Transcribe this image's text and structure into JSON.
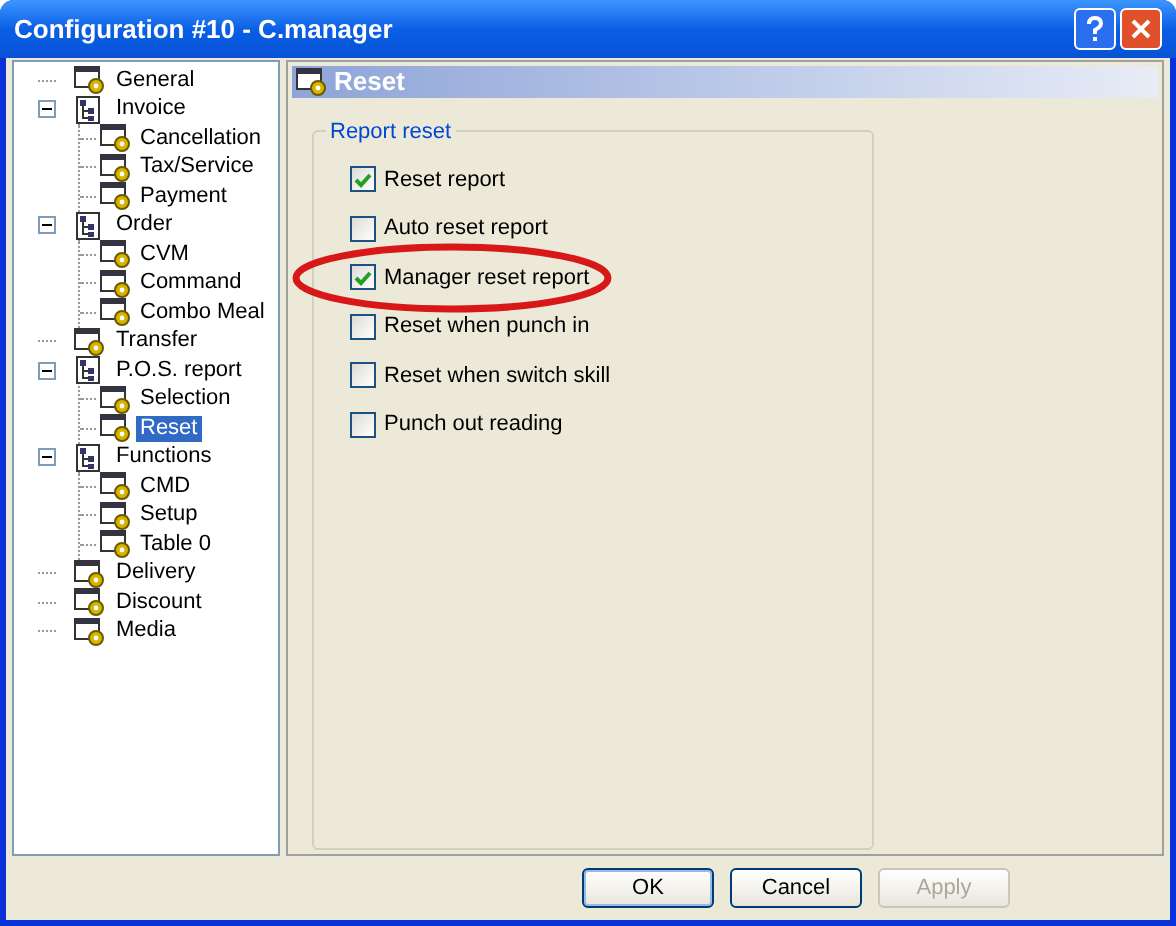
{
  "window": {
    "title": "Configuration #10 - C.manager"
  },
  "tree": [
    {
      "label": "General",
      "selected": false
    },
    {
      "label": "Invoice",
      "selected": false,
      "expanded": true,
      "children": [
        {
          "label": "Cancellation",
          "selected": false
        },
        {
          "label": "Tax/Service",
          "selected": false
        },
        {
          "label": "Payment",
          "selected": false
        }
      ]
    },
    {
      "label": "Order",
      "selected": false,
      "expanded": true,
      "children": [
        {
          "label": "CVM",
          "selected": false
        },
        {
          "label": "Command",
          "selected": false
        },
        {
          "label": "Combo Meal",
          "selected": false
        }
      ]
    },
    {
      "label": "Transfer",
      "selected": false
    },
    {
      "label": "P.O.S. report",
      "selected": false,
      "expanded": true,
      "children": [
        {
          "label": "Selection",
          "selected": false
        },
        {
          "label": "Reset",
          "selected": true
        }
      ]
    },
    {
      "label": "Functions",
      "selected": false,
      "expanded": true,
      "children": [
        {
          "label": "CMD",
          "selected": false
        },
        {
          "label": "Setup",
          "selected": false
        },
        {
          "label": "Table 0",
          "selected": false
        }
      ]
    },
    {
      "label": "Delivery",
      "selected": false
    },
    {
      "label": "Discount",
      "selected": false
    },
    {
      "label": "Media",
      "selected": false
    }
  ],
  "panel": {
    "title": "Reset",
    "group": "Report reset",
    "options": [
      {
        "label": "Reset report",
        "checked": true,
        "circled": false
      },
      {
        "label": "Auto reset report",
        "checked": false,
        "circled": false
      },
      {
        "label": "Manager reset report",
        "checked": true,
        "circled": true
      },
      {
        "label": "Reset when punch in",
        "checked": false,
        "circled": false
      },
      {
        "label": "Reset when switch skill",
        "checked": false,
        "circled": false
      },
      {
        "label": "Punch out reading",
        "checked": false,
        "circled": false
      }
    ]
  },
  "buttons": [
    {
      "label": "OK",
      "disabled": false,
      "default": true
    },
    {
      "label": "Cancel",
      "disabled": false,
      "default": false
    },
    {
      "label": "Apply",
      "disabled": true,
      "default": false
    }
  ]
}
